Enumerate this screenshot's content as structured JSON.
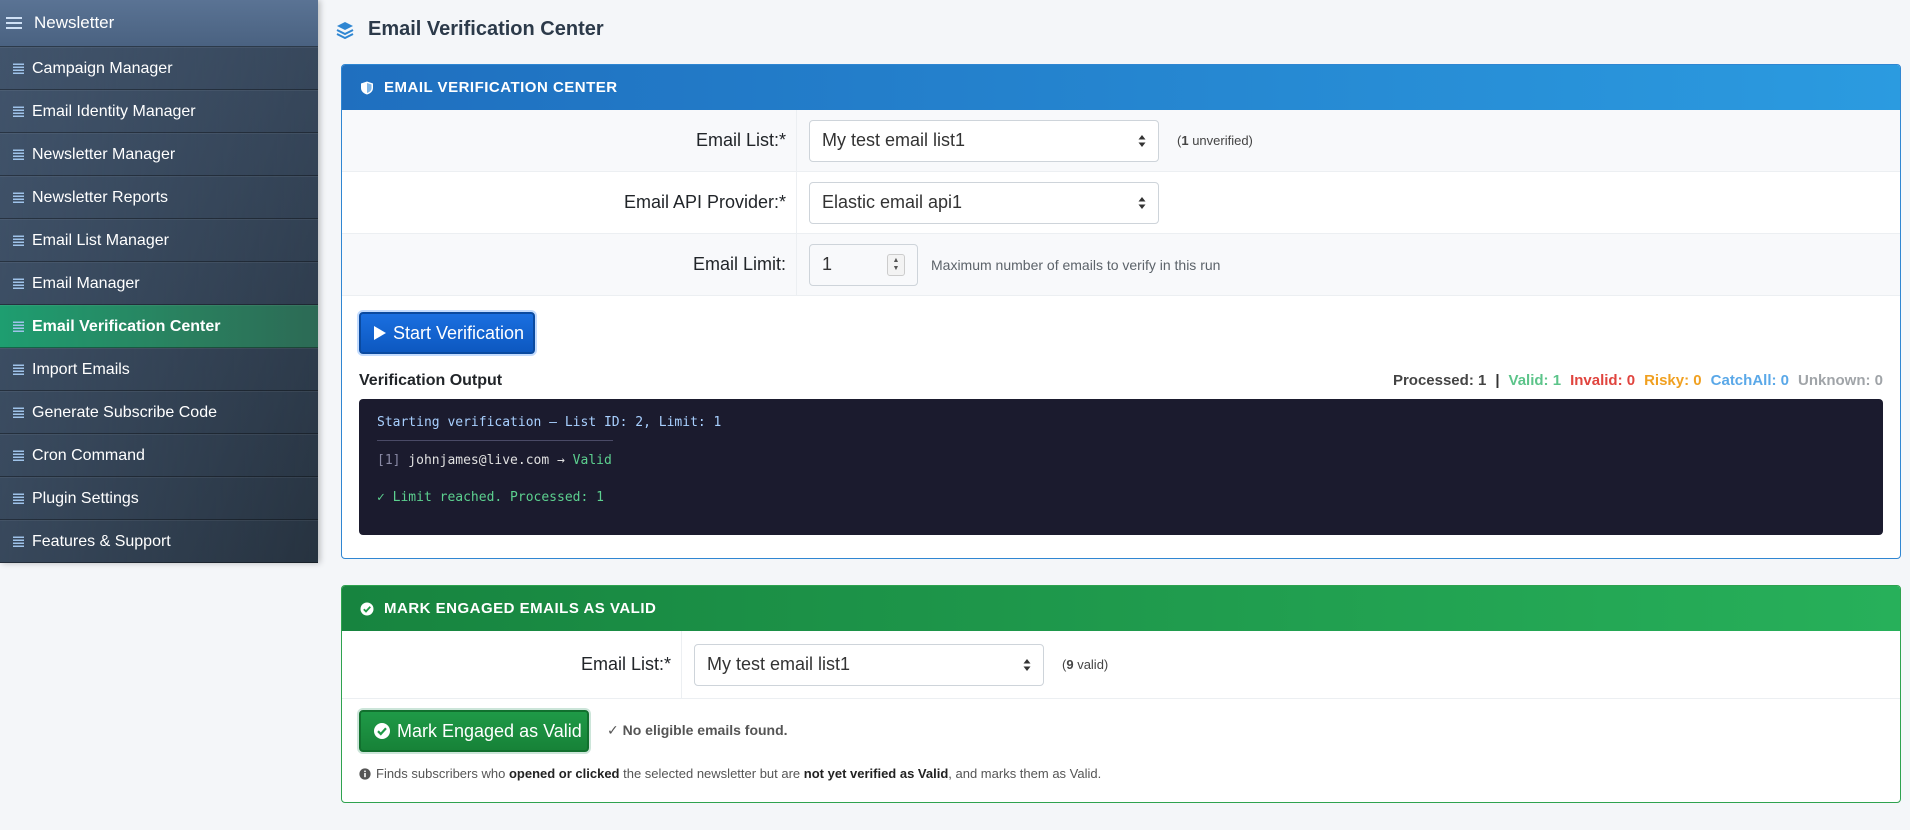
{
  "sidebar": {
    "title": "Newsletter",
    "items": [
      {
        "label": "Campaign Manager"
      },
      {
        "label": "Email Identity Manager"
      },
      {
        "label": "Newsletter Manager"
      },
      {
        "label": "Newsletter Reports"
      },
      {
        "label": "Email List Manager"
      },
      {
        "label": "Email Manager"
      },
      {
        "label": "Email Verification Center",
        "active": true
      },
      {
        "label": "Import Emails"
      },
      {
        "label": "Generate Subscribe Code"
      },
      {
        "label": "Cron Command"
      },
      {
        "label": "Plugin Settings"
      },
      {
        "label": "Features & Support"
      }
    ]
  },
  "page": {
    "title": "Email Verification Center"
  },
  "verify_card": {
    "header": "EMAIL VERIFICATION CENTER",
    "email_list_label": "Email List:*",
    "email_list_value": "My test email list1",
    "email_list_hint_open": "(",
    "email_list_hint_count": "1",
    "email_list_hint_rest": " unverified)",
    "api_label": "Email API Provider:*",
    "api_value": "Elastic email api1",
    "limit_label": "Email Limit:",
    "limit_value": "1",
    "limit_hint": "Maximum number of emails to verify in this run",
    "start_button": "Start Verification",
    "output_title": "Verification Output",
    "stats": {
      "processed": "Processed: 1",
      "separator": "|",
      "valid": "Valid: 1",
      "invalid": "Invalid: 0",
      "risky": "Risky: 0",
      "catchall": "CatchAll: 0",
      "unknown": "Unknown: 0"
    },
    "terminal": {
      "line1": "Starting verification — List ID: 2, Limit: 1",
      "line2_index": "[1]",
      "line2_email": " johnjames@live.com → ",
      "line2_status": "Valid",
      "line3": "✓ Limit reached. Processed: 1"
    }
  },
  "engaged_card": {
    "header": "MARK ENGAGED EMAILS AS VALID",
    "email_list_label": "Email List:*",
    "email_list_value": "My test email list1",
    "hint_open": "(",
    "hint_count": "9",
    "hint_rest": " valid)",
    "button": "Mark Engaged as Valid",
    "result_tick": "✓ ",
    "result_text": "No eligible emails found.",
    "note_1": "Finds subscribers who ",
    "note_2": "opened or clicked",
    "note_3": " the selected newsletter but are ",
    "note_4": "not yet verified as Valid",
    "note_5": ", and marks them as Valid."
  },
  "colors": {
    "sidebar_active": "#1e9e70",
    "primary": "#0d6efd",
    "success": "#198754",
    "stat_valid": "#5cc48a",
    "stat_invalid": "#e0443e",
    "stat_risky": "#f0a020",
    "stat_catchall": "#5aa8e8",
    "stat_unknown": "#a0a4a8"
  }
}
